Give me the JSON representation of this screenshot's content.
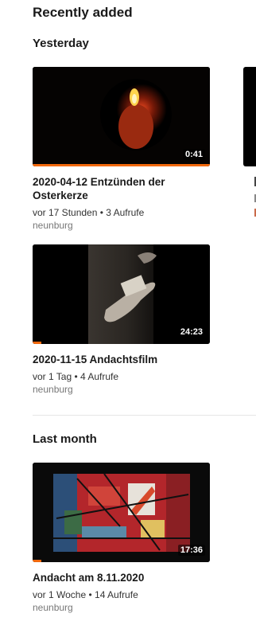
{
  "page_title": "Recently added",
  "sections": [
    {
      "title": "Yesterday",
      "videos": [
        {
          "title": "2020-04-12 Entzünden der Osterkerze",
          "age": "vor 17 Stunden",
          "views": "3 Aufrufe",
          "channel": "neunburg",
          "duration": "0:41",
          "watched_fraction": 1.0
        },
        {
          "title": "2020-11-15 Andachtsfilm",
          "age": "vor 1 Tag",
          "views": "4 Aufrufe",
          "channel": "neunburg",
          "duration": "24:23",
          "watched_fraction": 0.05
        }
      ]
    },
    {
      "title": "Last month",
      "videos": [
        {
          "title": "Andacht am 8.11.2020",
          "age": "vor 1 Woche",
          "views": "14 Aufrufe",
          "channel": "neunburg",
          "duration": "17:36",
          "watched_fraction": 0.05
        }
      ]
    }
  ],
  "colors": {
    "accent": "#f2690d"
  }
}
